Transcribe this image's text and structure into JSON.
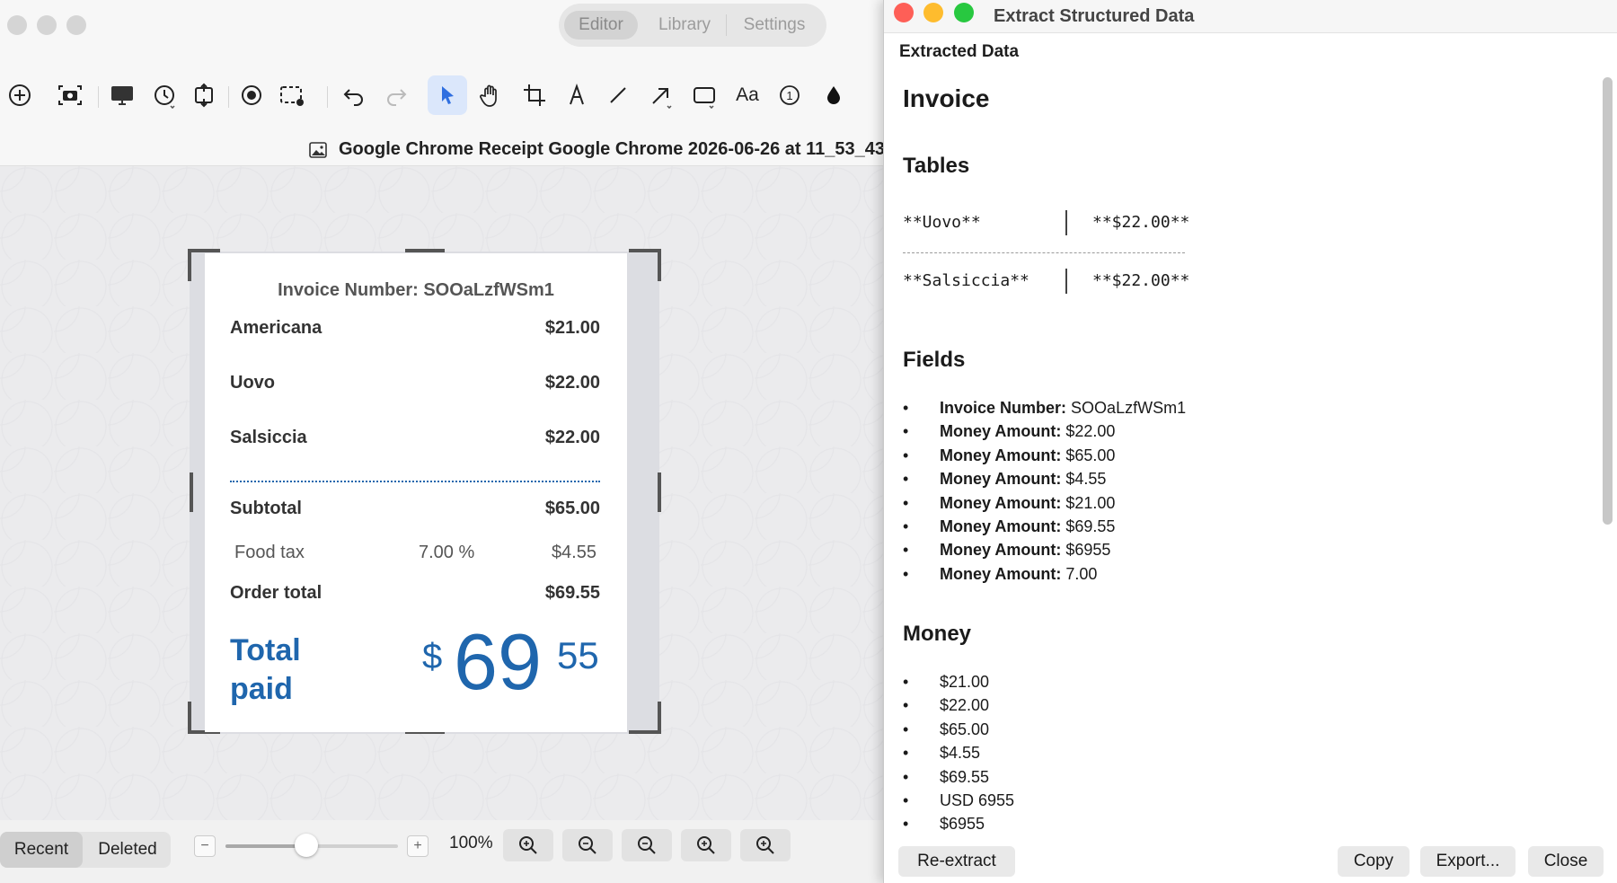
{
  "editor": {
    "tabs": [
      "Editor",
      "Library",
      "Settings"
    ],
    "file_title": "Google Chrome Receipt Google Chrome 2026-06-26 at 11_53_43",
    "toolbar_icons": [
      "add-icon",
      "screenshot-icon",
      "display-icon",
      "timer-icon",
      "resize-icon",
      "record-icon",
      "select-region-icon",
      "undo-icon",
      "redo-icon",
      "pointer-icon",
      "hand-icon",
      "crop-icon",
      "pen-icon",
      "line-icon",
      "arrow-icon",
      "rectangle-icon",
      "text-icon",
      "counter-icon",
      "fill-icon"
    ],
    "text_tool_label": "Aa",
    "counter_tool_label": "1"
  },
  "receipt": {
    "invoice_label": "Invoice Number: SOOaLzfWSm1",
    "items": [
      {
        "name": "Americana",
        "price": "$21.00"
      },
      {
        "name": "Uovo",
        "price": "$22.00"
      },
      {
        "name": "Salsiccia",
        "price": "$22.00"
      }
    ],
    "subtotal_label": "Subtotal",
    "subtotal_value": "$65.00",
    "tax_label": "Food tax",
    "tax_rate": "7.00 %",
    "tax_value": "$4.55",
    "order_total_label": "Order total",
    "order_total_value": "$69.55",
    "total_paid_line1": "Total",
    "total_paid_line2": "paid",
    "total_currency": "$",
    "total_dollars": "69",
    "total_cents": "55",
    "accent_color": "#1f66ad"
  },
  "status": {
    "segments": [
      "Recent",
      "Deleted"
    ],
    "zoom_minus": "−",
    "zoom_plus": "+",
    "zoom_label": "100%",
    "zoom_fraction": 0.47
  },
  "panel": {
    "title": "Extract Structured Data",
    "section_header": "Extracted Data",
    "doc_title": "Invoice",
    "tables_heading": "Tables",
    "table_rows": [
      {
        "left": "**Uovo**",
        "right": "**$22.00**"
      },
      {
        "left": "**Salsiccia**",
        "right": "**$22.00**"
      }
    ],
    "fields_heading": "Fields",
    "bullet": "•",
    "fields": [
      {
        "key": "Invoice Number:",
        "value": "SOOaLzfWSm1"
      },
      {
        "key": "Money Amount:",
        "value": "$22.00"
      },
      {
        "key": "Money Amount:",
        "value": "$65.00"
      },
      {
        "key": "Money Amount:",
        "value": "$4.55"
      },
      {
        "key": "Money Amount:",
        "value": "$21.00"
      },
      {
        "key": "Money Amount:",
        "value": "$69.55"
      },
      {
        "key": "Money Amount:",
        "value": "$6955"
      },
      {
        "key": "Money Amount:",
        "value": "7.00"
      }
    ],
    "money_heading": "Money",
    "money": [
      "$21.00",
      "$22.00",
      "$65.00",
      "$4.55",
      "$69.55",
      "USD 6955",
      "$6955"
    ],
    "buttons": {
      "reextract": "Re-extract",
      "copy": "Copy",
      "export": "Export...",
      "close": "Close"
    }
  }
}
